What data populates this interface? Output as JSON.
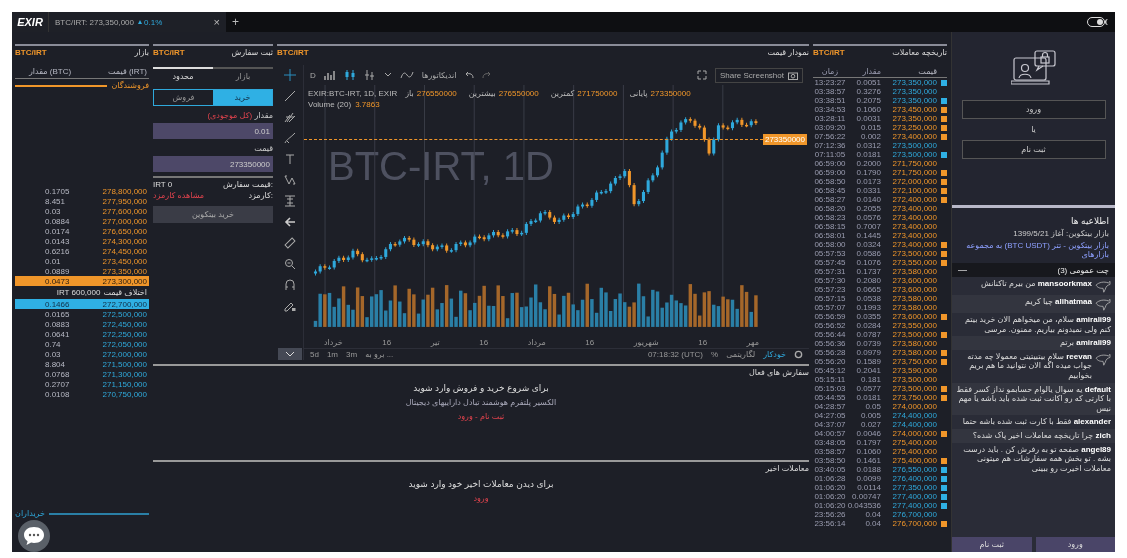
{
  "topbar": {
    "logo": "EXIR",
    "tab": {
      "pair": "BTC/IRT:",
      "price": "273,350,000",
      "change": "0.1%",
      "up": true,
      "close": "×"
    },
    "add": "+"
  },
  "orderbook": {
    "title": "بازار",
    "pair": "BTC/IRT",
    "col_amount": "مقدار (BTC)",
    "col_price": "قیمت (IRT)",
    "sellers": "فروشندگان",
    "buyers": "خریداران",
    "asks": [
      {
        "price": "278,800,000",
        "amount": "0.1705",
        "selected": false
      },
      {
        "price": "277,950,000",
        "amount": "8.451",
        "selected": false
      },
      {
        "price": "277,600,000",
        "amount": "0.03",
        "selected": false
      },
      {
        "price": "277,000,000",
        "amount": "0.0884",
        "selected": false
      },
      {
        "price": "276,650,000",
        "amount": "0.0174",
        "selected": false
      },
      {
        "price": "274,300,000",
        "amount": "0.0143",
        "selected": false
      },
      {
        "price": "274,450,000",
        "amount": "0.6216",
        "selected": false
      },
      {
        "price": "273,450,000",
        "amount": "0.01",
        "selected": false
      },
      {
        "price": "273,350,000",
        "amount": "0.0889",
        "selected": false
      },
      {
        "price": "273,300,000",
        "amount": "0.0473",
        "selected": true
      }
    ],
    "spread_label": "اختلاف قیمت",
    "spread": "IRT 600,000",
    "bids": [
      {
        "price": "272,700,000",
        "amount": "0.1466",
        "selected": true
      },
      {
        "price": "272,500,000",
        "amount": "0.0165",
        "selected": false
      },
      {
        "price": "272,450,000",
        "amount": "0.0883",
        "selected": false
      },
      {
        "price": "272,250,000",
        "amount": "0.0641",
        "selected": false
      },
      {
        "price": "272,050,000",
        "amount": "0.74",
        "selected": false
      },
      {
        "price": "272,000,000",
        "amount": "0.03",
        "selected": false
      },
      {
        "price": "271,500,000",
        "amount": "8.804",
        "selected": false
      },
      {
        "price": "271,300,000",
        "amount": "0.0768",
        "selected": false
      },
      {
        "price": "271,150,000",
        "amount": "0.2707",
        "selected": false
      },
      {
        "price": "270,750,000",
        "amount": "0.0108",
        "selected": false
      }
    ]
  },
  "order_form": {
    "title": "ثبت سفارش",
    "pair": "BTC/IRT",
    "types": [
      {
        "label": "بازار",
        "selected": false
      },
      {
        "label": "محدود",
        "selected": true
      }
    ],
    "sides": [
      {
        "label": "خرید",
        "selected": true
      },
      {
        "label": "فروش",
        "selected": false
      }
    ],
    "amount_label": "مقدار",
    "amount_hint": "(کل موجودی)",
    "amount": "0.01",
    "price_label": "قیمت",
    "price": "273350000",
    "total_label": "قیمت سفارش:",
    "total": "IRT 0",
    "fee_label": "کارمزد:",
    "fee_link": "مشاهده کارمزد",
    "submit": "خرید بیتکوین"
  },
  "chart": {
    "pair": "BTC/IRT",
    "title": "نمودار قیمت",
    "interval": "D",
    "indicators": "اندیکاتورها",
    "share": "Share Screenshot",
    "symbol": "EXIR:BTC-IRT, 1D, EXIR",
    "ohlc": {
      "open": {
        "label": "باز",
        "value": "276550000"
      },
      "high": {
        "label": "بیشترین",
        "value": "276550000"
      },
      "low": {
        "label": "کمترین",
        "value": "271750000"
      },
      "close": {
        "label": "پایانی",
        "value": "273350000"
      }
    },
    "volume_label": "Volume (20)",
    "volume": "3.7863",
    "watermark": "BTC-IRT, 1D",
    "last_price": "273350000",
    "x_labels": [
      "مهر",
      "16",
      "شهریور",
      "16",
      "مرداد",
      "16",
      "تیر",
      "16",
      "خرداد"
    ],
    "ranges": [
      "5d",
      "1m",
      "3m",
      "برو به ..."
    ],
    "time": "07:18:32 (UTC)",
    "percent": "%",
    "log": "لگاریتمی",
    "auto": "خودکار"
  },
  "active_orders": {
    "title": "سفارش های فعال",
    "message": "برای شروع خرید و فروش وارد شوید",
    "subtitle": "الکسیر پلتفرم هوشمند تبادل داراییهای دیجیتال",
    "link": "ثبت نام - ورود"
  },
  "recent_trades": {
    "title": "معاملات اخیر",
    "message": "برای دیدن معاملات اخیر خود وارد شوید",
    "link": "ورود"
  },
  "trade_history": {
    "title": "تاریخچه معاملات",
    "pair": "BTC/IRT",
    "col_price": "قیمت",
    "col_amount": "مقدار",
    "col_time": "زمان",
    "rows": [
      {
        "time": "13:23:27",
        "amount": "0.0051",
        "price": "273,350,000",
        "buy": true,
        "flag": true
      },
      {
        "time": "03:38:57",
        "amount": "0.3276",
        "price": "273,350,000",
        "buy": true,
        "flag": false
      },
      {
        "time": "03:38:51",
        "amount": "0.2075",
        "price": "273,350,000",
        "buy": true,
        "flag": true
      },
      {
        "time": "03:34:53",
        "amount": "0.1060",
        "price": "273,450,000",
        "buy": false,
        "flag": true
      },
      {
        "time": "03:28:11",
        "amount": "0.0031",
        "price": "273,350,000",
        "buy": false,
        "flag": true
      },
      {
        "time": "03:09:20",
        "amount": "0.015",
        "price": "273,250,000",
        "buy": false,
        "flag": true
      },
      {
        "time": "07:56:22",
        "amount": "0.002",
        "price": "273,400,000",
        "buy": false,
        "flag": true
      },
      {
        "time": "07:12:36",
        "amount": "0.0312",
        "price": "273,500,000",
        "buy": true,
        "flag": false
      },
      {
        "time": "07:11:05",
        "amount": "0.0181",
        "price": "273,500,000",
        "buy": true,
        "flag": true
      },
      {
        "time": "06:59:00",
        "amount": "0.2000",
        "price": "271,750,000",
        "buy": false,
        "flag": false
      },
      {
        "time": "06:59:00",
        "amount": "0.1790",
        "price": "271,750,000",
        "buy": false,
        "flag": true
      },
      {
        "time": "06:58:50",
        "amount": "0.0173",
        "price": "272,000,000",
        "buy": false,
        "flag": true
      },
      {
        "time": "06:58:45",
        "amount": "0.0331",
        "price": "272,100,000",
        "buy": false,
        "flag": true
      },
      {
        "time": "06:58:27",
        "amount": "0.0140",
        "price": "272,400,000",
        "buy": false,
        "flag": true
      },
      {
        "time": "06:58:20",
        "amount": "0.2055",
        "price": "273,400,000",
        "buy": false,
        "flag": false
      },
      {
        "time": "06:58:23",
        "amount": "0.0576",
        "price": "273,400,000",
        "buy": false,
        "flag": false
      },
      {
        "time": "06:58:15",
        "amount": "0.7007",
        "price": "273,400,000",
        "buy": false,
        "flag": false
      },
      {
        "time": "06:58:01",
        "amount": "0.1445",
        "price": "273,400,000",
        "buy": false,
        "flag": false
      },
      {
        "time": "06:58:00",
        "amount": "0.0324",
        "price": "273,400,000",
        "buy": false,
        "flag": true
      },
      {
        "time": "05:57:53",
        "amount": "0.0586",
        "price": "273,500,000",
        "buy": false,
        "flag": true
      },
      {
        "time": "05:57:45",
        "amount": "0.1076",
        "price": "273,550,000",
        "buy": false,
        "flag": true
      },
      {
        "time": "05:57:31",
        "amount": "0.1737",
        "price": "273,580,000",
        "buy": false,
        "flag": false
      },
      {
        "time": "05:57:30",
        "amount": "0.2080",
        "price": "273,600,000",
        "buy": false,
        "flag": false
      },
      {
        "time": "05:57:23",
        "amount": "0.0665",
        "price": "273,600,000",
        "buy": false,
        "flag": false
      },
      {
        "time": "05:57:15",
        "amount": "0.0538",
        "price": "273,580,000",
        "buy": false,
        "flag": false
      },
      {
        "time": "05:57:07",
        "amount": "0.1993",
        "price": "273,580,000",
        "buy": false,
        "flag": false
      },
      {
        "time": "05:56:59",
        "amount": "0.0355",
        "price": "273,600,000",
        "buy": false,
        "flag": true
      },
      {
        "time": "05:56:52",
        "amount": "0.0284",
        "price": "273,550,000",
        "buy": false,
        "flag": false
      },
      {
        "time": "05:56:44",
        "amount": "0.0787",
        "price": "273,500,000",
        "buy": false,
        "flag": true
      },
      {
        "time": "05:56:36",
        "amount": "0.0739",
        "price": "273,580,000",
        "buy": false,
        "flag": false
      },
      {
        "time": "05:56:28",
        "amount": "0.0979",
        "price": "273,580,000",
        "buy": false,
        "flag": true
      },
      {
        "time": "05:56:20",
        "amount": "0.1589",
        "price": "273,750,000",
        "buy": false,
        "flag": true
      },
      {
        "time": "05:45:12",
        "amount": "0.2041",
        "price": "273,590,000",
        "buy": false,
        "flag": false
      },
      {
        "time": "05:15:11",
        "amount": "0.181",
        "price": "273,500,000",
        "buy": false,
        "flag": false
      },
      {
        "time": "05:15:03",
        "amount": "0.0577",
        "price": "273,500,000",
        "buy": false,
        "flag": true
      },
      {
        "time": "05:44:55",
        "amount": "0.0181",
        "price": "273,750,000",
        "buy": false,
        "flag": true
      },
      {
        "time": "04:28:57",
        "amount": "0.05",
        "price": "274,000,000",
        "buy": false,
        "flag": false
      },
      {
        "time": "04:27:05",
        "amount": "0.005",
        "price": "274,400,000",
        "buy": true,
        "flag": false
      },
      {
        "time": "04:37:07",
        "amount": "0.027",
        "price": "274,400,000",
        "buy": true,
        "flag": false
      },
      {
        "time": "04:00:57",
        "amount": "0.0046",
        "price": "274,000,000",
        "buy": false,
        "flag": true
      },
      {
        "time": "03:48:05",
        "amount": "0.1797",
        "price": "275,400,000",
        "buy": false,
        "flag": false
      },
      {
        "time": "03:58:57",
        "amount": "0.1060",
        "price": "275,400,000",
        "buy": false,
        "flag": false
      },
      {
        "time": "03:58:50",
        "amount": "0.1461",
        "price": "275,400,000",
        "buy": false,
        "flag": true
      },
      {
        "time": "03:40:05",
        "amount": "0.0188",
        "price": "276,550,000",
        "buy": true,
        "flag": true
      },
      {
        "time": "01:06:28",
        "amount": "0.0099",
        "price": "276,400,000",
        "buy": true,
        "flag": true
      },
      {
        "time": "01:06:20",
        "amount": "0.0114",
        "price": "277,350,000",
        "buy": true,
        "flag": true
      },
      {
        "time": "01:06:20",
        "amount": "0.00747",
        "price": "277,400,000",
        "buy": true,
        "flag": true
      },
      {
        "time": "01:06:20",
        "amount": "0.043536",
        "price": "277,400,000",
        "buy": true,
        "flag": true
      },
      {
        "time": "23:56:26",
        "amount": "0.04",
        "price": "276,700,000",
        "buy": true,
        "flag": false
      },
      {
        "time": "23:56:14",
        "amount": "0.04",
        "price": "276,700,000",
        "buy": false,
        "flag": true
      }
    ]
  },
  "account": {
    "login": "ورود",
    "or": "یا",
    "signup": "ثبت نام"
  },
  "announcements": {
    "title": "اطلاعیه ها",
    "items": [
      "بازار بیتکوین: آغاز 1399/5/21",
      "بازار بیتکوین - تتر (BTC USDT) به مجموعه بازارهای"
    ]
  },
  "chat": {
    "title": "چت عمومی (3)",
    "minimize": "—",
    "messages": [
      {
        "user": "mansoorkmax",
        "text": "من بیرم تاکنانش",
        "avatar": true
      },
      {
        "user": "alihatmaa",
        "text": "چیا کریم",
        "avatar": true
      },
      {
        "user": "amirali99",
        "text": "سلام، من میخواهم الان خرید بیتم کنم ولی نمیدونم بیاریم. ممنون. مرسی",
        "avatar": false
      },
      {
        "user": "amirali99",
        "text": "برتم",
        "avatar": false
      },
      {
        "user": "reevan",
        "text": "سلام بیتبیتیتی معمولا چه مدته جواب میده اگه الان نتوانید ما هم بریم بخوابیم",
        "avatar": true
      },
      {
        "user": "default",
        "text": "یه سوال یالوام حسابمو نداز کسر فقط با کارتی که رو اکانت ثبت شده باید باشه یا مهم نیس",
        "avatar": false
      },
      {
        "user": "alexander",
        "text": "فقط با کارت ثبت شده باشه حتما",
        "avatar": false
      },
      {
        "user": "zich",
        "text": "چرا تاریخچه معاملات اخیر پاک شده؟",
        "avatar": false
      },
      {
        "user": "angel89",
        "text": "صفحه تو به رفرش کن . باید درست بشه . تو بخش همه سفارشات هم میتونی معاملات اخیرت رو ببینی",
        "avatar": false
      }
    ],
    "login": "ورود",
    "signup": "ثبت نام"
  }
}
